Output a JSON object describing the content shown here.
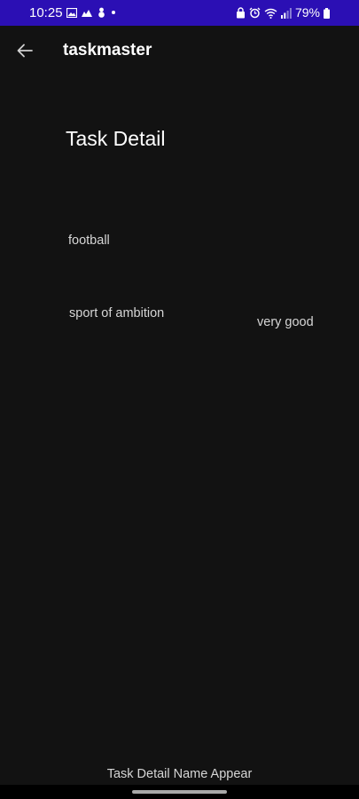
{
  "status_bar": {
    "time": "10:25",
    "battery": "79%",
    "left_icons": [
      "gallery-icon",
      "photo-icon",
      "snowman-icon",
      "dot-icon"
    ],
    "right_icons": [
      "lock-icon",
      "alarm-icon",
      "wifi-icon",
      "signal-icon",
      "battery-icon"
    ],
    "color": "#2b0fb4"
  },
  "app_bar": {
    "title": "taskmaster",
    "back_icon": "arrow-left-icon"
  },
  "main": {
    "page_title": "Task Detail",
    "task_name": "football",
    "task_body": "sport of ambition",
    "task_state": "very good"
  },
  "footer": {
    "text": "Task Detail Name Appear"
  },
  "theme": {
    "background": "#121212",
    "text_primary": "#ffffff",
    "text_secondary": "#d6d6d6"
  }
}
